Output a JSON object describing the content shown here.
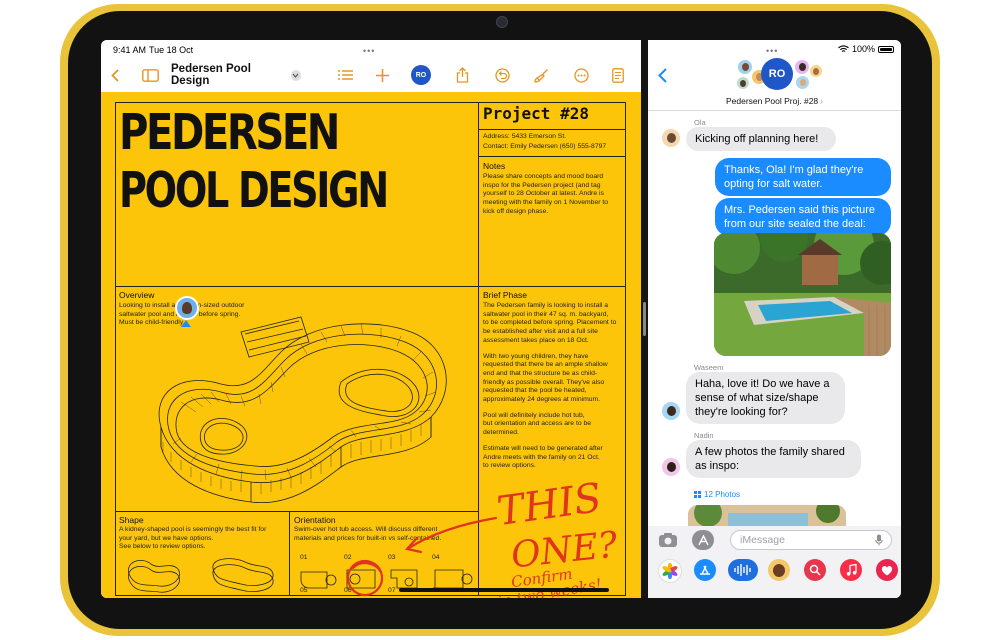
{
  "colors": {
    "accent": "#e5961e",
    "doc": "#fcc50a",
    "bubble_out": "#1a8cff",
    "ink": "#e0341e",
    "device": "#e9c33a"
  },
  "status": {
    "time": "9:41 AM",
    "date": "Tue 18 Oct",
    "battery": "100%"
  },
  "pages": {
    "doc_title": "Pedersen Pool Design",
    "collab_initials": "RO",
    "heading_line1": "PEDERSEN",
    "heading_line2": "POOL DESIGN",
    "project": "Project #28",
    "address": "Address: 5433 Emerson St.",
    "contact": "Contact: Emily Pedersen (650) 555-8797",
    "notes_title": "Notes",
    "notes_body": [
      "Please share concepts and mood board",
      "inspo for the Pedersen project (and tag",
      "yourself to 28 October at latest. Andre is",
      "meeting with the family on 1 November to",
      "kick off design phase."
    ],
    "overview_title": "Overview",
    "overview_body": [
      "Looking to install a medium-sized outdoor",
      "saltwater pool and hot tub before spring.",
      "Must be child-friendly."
    ],
    "brief_title": "Brief Phase",
    "brief_body": [
      "The Pedersen family is looking to install a",
      "saltwater pool in their 47 sq. m. backyard,",
      "to be completed before spring. Placement to",
      "be established after visit and a full site",
      "assessment takes place on 18 Oct.",
      "",
      "With two young children, they have",
      "requested that there be an ample shallow",
      "end and that the structure be as child-",
      "friendly as possible overall. They've also",
      "requested that the pool be heated,",
      "approximately 24 degrees at minimum.",
      "",
      "Pool will definitely include hot tub,",
      "but orientation and access are to be",
      "determined.",
      "",
      "Estimate will need to be generated after",
      "Andre meets with the family on 21 Oct.",
      "to review options."
    ],
    "shape_title": "Shape",
    "shape_body": [
      "A kidney-shaped pool is seemingly the best fit for",
      "your yard, but we have options.",
      "See below to review options."
    ],
    "orient_title": "Orientation",
    "orient_body": [
      "Swim-over hot tub access. Will discuss different",
      "materials and prices for built-in vs self-contained."
    ],
    "orient_nums": [
      "01",
      "02",
      "03",
      "04",
      "05",
      "06",
      "07",
      "08"
    ],
    "handwriting": [
      "THIS",
      "ONE?",
      "Confirm",
      "in two weeks!"
    ]
  },
  "messages": {
    "group_title": "Pedersen Pool Proj. #28",
    "group_initials": "RO",
    "items": [
      {
        "sender": "Ola",
        "text": "Kicking off planning here!"
      },
      {
        "text": "Thanks, Ola! I'm glad they're opting for salt water."
      },
      {
        "text": "Mrs. Pedersen said this picture from our site sealed the deal:"
      },
      {
        "sender": "Waseem",
        "text": "Haha, love it! Do we have a sense of what size/shape they're looking for?"
      },
      {
        "sender": "Nadin",
        "text": "A few photos the family shared as inspo:"
      }
    ],
    "photos_label": "12 Photos",
    "input_placeholder": "iMessage"
  },
  "icons": [
    "chevron-left-icon",
    "sidebar-icon",
    "chevron-down-icon",
    "list-icon",
    "plus-icon",
    "share-icon",
    "undo-icon",
    "brush-icon",
    "more-icon",
    "document-icon",
    "camera-icon",
    "apps-icon",
    "mic-icon",
    "photos-app-icon",
    "appstore-app-icon",
    "audio-app-icon",
    "memoji-app-icon",
    "search-app-icon",
    "music-app-icon",
    "heart-app-icon"
  ]
}
